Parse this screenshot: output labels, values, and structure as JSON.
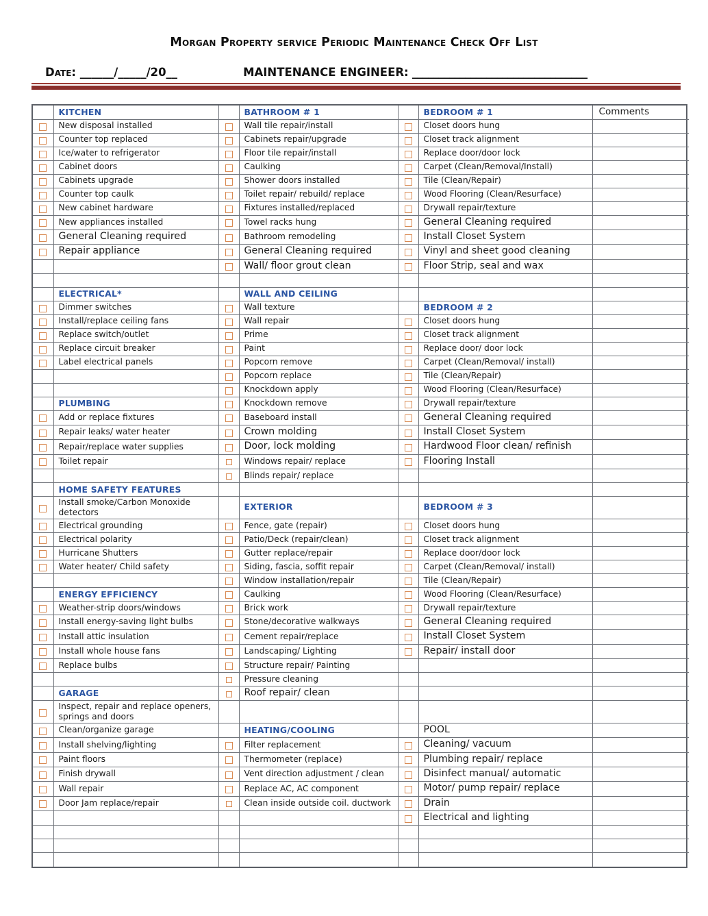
{
  "header": {
    "title": "Morgan Property service Periodic Maintenance Check Off List",
    "date_label": "Date:",
    "date_blanks": " ______/_____/20__",
    "engineer_label": "MAINTENANCE ENGINEER:",
    "engineer_blanks": " _________________________________"
  },
  "columns": {
    "comments_header": "Comments"
  },
  "colors": {
    "section_heading": "#2b55a3",
    "checkbox_border": "#d98a52",
    "rule": "#8a2f2b",
    "grid_line": "#6f737a"
  },
  "rows": [
    {
      "a": {
        "t": "KITCHEN",
        "s": "section"
      },
      "b": {
        "t": "BATHROOM # 1",
        "s": "section"
      },
      "c": {
        "t": "BEDROOM # 1",
        "s": "section"
      },
      "comments": "Comments"
    },
    {
      "a": {
        "t": "New disposal installed",
        "k": 1
      },
      "b": {
        "t": "Wall tile repair/install",
        "k": 1
      },
      "c": {
        "t": "Closet doors hung",
        "k": 1
      }
    },
    {
      "a": {
        "t": "Counter top replaced",
        "k": 1
      },
      "b": {
        "t": "Cabinets repair/upgrade",
        "k": 1
      },
      "c": {
        "t": "Closet track alignment",
        "k": 1
      }
    },
    {
      "a": {
        "t": "Ice/water to refrigerator",
        "k": 1
      },
      "b": {
        "t": "Floor tile repair/install",
        "k": 1
      },
      "c": {
        "t": "Replace door/door lock",
        "k": 1
      }
    },
    {
      "a": {
        "t": "Cabinet doors",
        "k": 1
      },
      "b": {
        "t": "Caulking",
        "k": 1
      },
      "c": {
        "t": "Carpet (Clean/Removal/Install)",
        "k": 1
      }
    },
    {
      "a": {
        "t": "Cabinets upgrade",
        "k": 1
      },
      "b": {
        "t": "Shower doors installed",
        "k": 1
      },
      "c": {
        "t": "Tile (Clean/Repair)",
        "k": 1
      }
    },
    {
      "a": {
        "t": "Counter top caulk",
        "k": 1
      },
      "b": {
        "t": "Toilet repair/ rebuild/ replace",
        "k": 1
      },
      "c": {
        "t": "Wood Flooring (Clean/Resurface)",
        "k": 1
      }
    },
    {
      "a": {
        "t": "New cabinet hardware",
        "k": 1
      },
      "b": {
        "t": "Fixtures installed/replaced",
        "k": 1
      },
      "c": {
        "t": "Drywall repair/texture",
        "k": 1
      }
    },
    {
      "a": {
        "t": "New appliances installed",
        "k": 1
      },
      "b": {
        "t": "Towel racks hung",
        "k": 1
      },
      "c": {
        "t": "General Cleaning required",
        "k": 1,
        "s": "big"
      }
    },
    {
      "a": {
        "t": "General Cleaning required",
        "k": 1,
        "s": "big"
      },
      "b": {
        "t": "Bathroom remodeling",
        "k": 1
      },
      "c": {
        "t": "Install Closet System",
        "k": 1,
        "s": "big"
      }
    },
    {
      "a": {
        "t": "Repair appliance",
        "k": 1,
        "s": "big"
      },
      "b": {
        "t": "General Cleaning required",
        "k": 1,
        "s": "big"
      },
      "c": {
        "t": "Vinyl and sheet good cleaning",
        "k": 1,
        "s": "big"
      }
    },
    {
      "a": {
        "t": ""
      },
      "b": {
        "t": "Wall/ floor grout clean",
        "k": 1,
        "s": "big"
      },
      "c": {
        "t": "Floor Strip, seal and wax",
        "k": 1,
        "s": "big"
      }
    },
    {
      "a": {
        "t": ""
      },
      "b": {
        "t": ""
      },
      "c": {
        "t": ""
      }
    },
    {
      "a": {
        "t": "ELECTRICAL*",
        "s": "section"
      },
      "b": {
        "t": "WALL AND CEILING",
        "s": "section"
      },
      "c": {
        "t": ""
      }
    },
    {
      "a": {
        "t": "Dimmer switches",
        "k": 1
      },
      "b": {
        "t": "Wall texture",
        "k": 1
      },
      "c": {
        "t": "BEDROOM # 2",
        "s": "section"
      }
    },
    {
      "a": {
        "t": "Install/replace ceiling fans",
        "k": 1
      },
      "b": {
        "t": "Wall repair",
        "k": 1
      },
      "c": {
        "t": "Closet doors hung",
        "k": 1
      }
    },
    {
      "a": {
        "t": "Replace switch/outlet",
        "k": 1
      },
      "b": {
        "t": "Prime",
        "k": 1
      },
      "c": {
        "t": "Closet track alignment",
        "k": 1
      }
    },
    {
      "a": {
        "t": "Replace circuit breaker",
        "k": 1
      },
      "b": {
        "t": "Paint",
        "k": 1
      },
      "c": {
        "t": "Replace door/ door lock",
        "k": 1
      }
    },
    {
      "a": {
        "t": "Label electrical panels",
        "k": 1
      },
      "b": {
        "t": "Popcorn remove",
        "k": 1
      },
      "c": {
        "t": "Carpet (Clean/Removal/ install)",
        "k": 1
      }
    },
    {
      "a": {
        "t": ""
      },
      "b": {
        "t": "Popcorn replace",
        "k": 1
      },
      "c": {
        "t": "Tile (Clean/Repair)",
        "k": 1
      }
    },
    {
      "a": {
        "t": ""
      },
      "b": {
        "t": "Knockdown apply",
        "k": 1
      },
      "c": {
        "t": "Wood Flooring (Clean/Resurface)",
        "k": 1
      }
    },
    {
      "a": {
        "t": "PLUMBING",
        "s": "section"
      },
      "b": {
        "t": "Knockdown remove",
        "k": 1
      },
      "c": {
        "t": "Drywall repair/texture",
        "k": 1
      }
    },
    {
      "a": {
        "t": "Add or replace fixtures",
        "k": 1
      },
      "b": {
        "t": "Baseboard install",
        "k": 1
      },
      "c": {
        "t": "General Cleaning required",
        "k": 1,
        "s": "big"
      }
    },
    {
      "a": {
        "t": "Repair leaks/ water heater",
        "k": 1
      },
      "b": {
        "t": "Crown molding",
        "k": 1,
        "s": "big"
      },
      "c": {
        "t": "Install Closet System",
        "k": 1,
        "s": "big"
      }
    },
    {
      "a": {
        "t": "Repair/replace water supplies",
        "k": 1
      },
      "b": {
        "t": "Door, lock molding",
        "k": 1,
        "s": "big"
      },
      "c": {
        "t": "Hardwood Floor clean/ refinish",
        "k": 1,
        "s": "big"
      }
    },
    {
      "a": {
        "t": "Toilet repair",
        "k": 1
      },
      "b": {
        "t": "Windows repair/ replace",
        "k": 2
      },
      "c": {
        "t": "Flooring Install",
        "k": 1,
        "s": "big"
      }
    },
    {
      "a": {
        "t": ""
      },
      "b": {
        "t": "Blinds repair/ replace",
        "k": 2
      },
      "c": {
        "t": ""
      }
    },
    {
      "a": {
        "t": "HOME SAFETY FEATURES",
        "s": "section"
      },
      "b": {
        "t": ""
      },
      "c": {
        "t": ""
      }
    },
    {
      "tall": 1,
      "a": {
        "t": "Install smoke/Carbon Monoxide detectors",
        "k": 1
      },
      "b": {
        "t": "EXTERIOR",
        "s": "section"
      },
      "c": {
        "t": "BEDROOM # 3",
        "s": "section"
      }
    },
    {
      "a": {
        "t": "Electrical grounding",
        "k": 1
      },
      "b": {
        "t": "Fence, gate (repair)",
        "k": 1
      },
      "c": {
        "t": "Closet doors hung",
        "k": 1
      }
    },
    {
      "a": {
        "t": "Electrical polarity",
        "k": 1
      },
      "b": {
        "t": "Patio/Deck (repair/clean)",
        "k": 1
      },
      "c": {
        "t": "Closet track alignment",
        "k": 1
      }
    },
    {
      "a": {
        "t": "Hurricane Shutters",
        "k": 1
      },
      "b": {
        "t": "Gutter replace/repair",
        "k": 1
      },
      "c": {
        "t": "Replace door/door lock",
        "k": 1
      }
    },
    {
      "a": {
        "t": "Water heater/ Child safety",
        "k": 1
      },
      "b": {
        "t": "Siding, fascia, soffit repair",
        "k": 1
      },
      "c": {
        "t": "Carpet (Clean/Removal/ install)",
        "k": 1
      }
    },
    {
      "a": {
        "t": ""
      },
      "b": {
        "t": "Window installation/repair",
        "k": 1
      },
      "c": {
        "t": "Tile (Clean/Repair)",
        "k": 1
      }
    },
    {
      "a": {
        "t": "ENERGY EFFICIENCY",
        "s": "section"
      },
      "b": {
        "t": "Caulking",
        "k": 1
      },
      "c": {
        "t": "Wood Flooring (Clean/Resurface)",
        "k": 1
      }
    },
    {
      "a": {
        "t": "Weather-strip doors/windows",
        "k": 1
      },
      "b": {
        "t": "Brick work",
        "k": 1
      },
      "c": {
        "t": "Drywall repair/texture",
        "k": 1
      }
    },
    {
      "a": {
        "t": "Install energy-saving light bulbs",
        "k": 1
      },
      "b": {
        "t": "Stone/decorative walkways",
        "k": 1
      },
      "c": {
        "t": "General Cleaning required",
        "k": 1,
        "s": "big"
      }
    },
    {
      "a": {
        "t": "Install attic insulation",
        "k": 1
      },
      "b": {
        "t": "Cement repair/replace",
        "k": 1
      },
      "c": {
        "t": "Install Closet System",
        "k": 1,
        "s": "big"
      }
    },
    {
      "a": {
        "t": "Install whole house fans",
        "k": 1
      },
      "b": {
        "t": "Landscaping/ Lighting",
        "k": 1
      },
      "c": {
        "t": "Repair/ install door",
        "k": 1,
        "s": "big"
      }
    },
    {
      "a": {
        "t": "Replace bulbs",
        "k": 1
      },
      "b": {
        "t": "Structure repair/ Painting",
        "k": 1
      },
      "c": {
        "t": ""
      }
    },
    {
      "a": {
        "t": ""
      },
      "b": {
        "t": "Pressure cleaning",
        "k": 2
      },
      "c": {
        "t": ""
      }
    },
    {
      "a": {
        "t": "GARAGE",
        "s": "section"
      },
      "b": {
        "t": "Roof repair/ clean",
        "k": 2,
        "s": "big"
      },
      "c": {
        "t": ""
      }
    },
    {
      "tall": 1,
      "a": {
        "t": "Inspect, repair and replace openers, springs and doors",
        "k": 1
      },
      "b": {
        "t": ""
      },
      "c": {
        "t": ""
      }
    },
    {
      "a": {
        "t": "Clean/organize garage",
        "k": 1
      },
      "b": {
        "t": "HEATING/COOLING",
        "s": "section"
      },
      "c": {
        "t": "POOL",
        "s": "section-plain"
      }
    },
    {
      "a": {
        "t": "Install shelving/lighting",
        "k": 1
      },
      "b": {
        "t": "Filter replacement",
        "k": 1
      },
      "c": {
        "t": "Cleaning/ vacuum",
        "k": 1,
        "s": "big"
      }
    },
    {
      "a": {
        "t": "Paint floors",
        "k": 1
      },
      "b": {
        "t": "Thermometer (replace)",
        "k": 1
      },
      "c": {
        "t": "Plumbing repair/ replace",
        "k": 1,
        "s": "big"
      }
    },
    {
      "a": {
        "t": "Finish drywall",
        "k": 1
      },
      "b": {
        "t": "Vent direction adjustment / clean",
        "k": 1
      },
      "c": {
        "t": "Disinfect  manual/ automatic",
        "k": 1,
        "s": "big"
      }
    },
    {
      "a": {
        "t": "Wall repair",
        "k": 1
      },
      "b": {
        "t": "Replace AC, AC component",
        "k": 1
      },
      "c": {
        "t": "Motor/ pump repair/ replace",
        "k": 1,
        "s": "big"
      }
    },
    {
      "a": {
        "t": "Door Jam replace/repair",
        "k": 1
      },
      "b": {
        "t": "Clean inside outside coil. ductwork",
        "k": 2
      },
      "c": {
        "t": "Drain",
        "k": 1,
        "s": "big"
      }
    },
    {
      "a": {
        "t": ""
      },
      "b": {
        "t": ""
      },
      "c": {
        "t": "Electrical and lighting",
        "k": 1,
        "s": "big"
      }
    },
    {
      "a": {
        "t": ""
      },
      "b": {
        "t": ""
      },
      "c": {
        "t": ""
      }
    },
    {
      "a": {
        "t": ""
      },
      "b": {
        "t": ""
      },
      "c": {
        "t": ""
      }
    },
    {
      "a": {
        "t": ""
      },
      "b": {
        "t": ""
      },
      "c": {
        "t": ""
      }
    }
  ]
}
